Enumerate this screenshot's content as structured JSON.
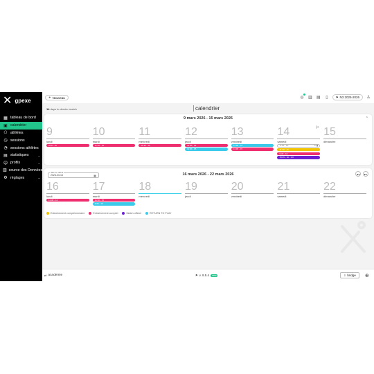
{
  "app": {
    "logo_text": "gpexe"
  },
  "sidebar": {
    "items": [
      {
        "label": "tableau de bord",
        "icon": "dashboard-icon",
        "glyph": "▦",
        "active": false,
        "caret": false
      },
      {
        "label": "calendrier",
        "icon": "calendar-icon",
        "glyph": "▣",
        "active": true,
        "caret": false
      },
      {
        "label": "athlètes",
        "icon": "athletes-icon",
        "glyph": "⚇",
        "active": false,
        "caret": false
      },
      {
        "label": "sessions",
        "icon": "sessions-icon",
        "glyph": "◷",
        "active": false,
        "caret": false
      },
      {
        "label": "sessions athlètes",
        "icon": "athlete-sessions-icon",
        "glyph": "◔",
        "active": false,
        "caret": false
      },
      {
        "label": "statistiques",
        "icon": "statistics-icon",
        "glyph": "▤",
        "active": false,
        "caret": true
      },
      {
        "label": "profils",
        "icon": "profiles-icon",
        "glyph": "☺",
        "active": false,
        "caret": true
      },
      {
        "label": "source des Données",
        "icon": "data-source-icon",
        "glyph": "▥",
        "active": false,
        "caret": false
      },
      {
        "label": "réglages",
        "icon": "settings-icon",
        "glyph": "⚙",
        "active": false,
        "caret": true
      }
    ]
  },
  "topbar": {
    "new_label": "Nouveau",
    "season_label": "N3 2025-2026"
  },
  "header": {
    "subtitle_prefix": "14",
    "subtitle_rest": "days to demier match",
    "title": "calendrier"
  },
  "weeks": [
    {
      "title": "9 mars 2026 - 15 mars 2026",
      "days": [
        {
          "num": "9",
          "name": "lundi",
          "today": false,
          "events": [
            {
              "t": "9:30 - 10",
              "c": "pink"
            }
          ]
        },
        {
          "num": "10",
          "name": "mardi",
          "today": false,
          "events": [
            {
              "t": "11:30 - 15",
              "c": "pink"
            }
          ]
        },
        {
          "num": "11",
          "name": "mercredi",
          "today": false,
          "events": [
            {
              "t": "11:30 - 15",
              "c": "pink"
            }
          ]
        },
        {
          "num": "12",
          "name": "jeudi",
          "today": false,
          "events": [
            {
              "t": "11:30 - 12",
              "c": "pink"
            },
            {
              "t": "11:30 - 15",
              "c": "cyan"
            }
          ]
        },
        {
          "num": "13",
          "name": "vendredi",
          "today": false,
          "events": [
            {
              "t": "11:30 - 12",
              "c": "cyan"
            },
            {
              "t": "11:30 - 15",
              "c": "pink"
            }
          ]
        },
        {
          "num": "14",
          "name": "samedi",
          "today": false,
          "events": [
            {
              "t": "9:30 - 10",
              "c": "edit"
            },
            {
              "t": "11:30 - 12",
              "c": "yellow"
            },
            {
              "t": "9:30 - 10",
              "c": "pink"
            },
            {
              "t": "15:45 - 16 - 2:0",
              "c": "purple"
            }
          ]
        },
        {
          "num": "15",
          "name": "dimanche",
          "today": false,
          "events": []
        }
      ]
    },
    {
      "title": "16 mars 2026 - 22 mars 2026",
      "date_label": "date de début",
      "date_value": "2026-03-16",
      "days": [
        {
          "num": "16",
          "name": "lundi",
          "today": false,
          "events": [
            {
              "t": "11:30 - 12",
              "c": "pink"
            }
          ]
        },
        {
          "num": "17",
          "name": "mardi",
          "today": false,
          "events": [
            {
              "t": "11:30 - 15",
              "c": "pink"
            },
            {
              "t": "9:30 - 10",
              "c": "cyan"
            }
          ]
        },
        {
          "num": "18",
          "name": "mercredi",
          "today": true,
          "events": []
        },
        {
          "num": "19",
          "name": "jeudi",
          "today": false,
          "events": []
        },
        {
          "num": "20",
          "name": "vendredi",
          "today": false,
          "events": []
        },
        {
          "num": "21",
          "name": "samedi",
          "today": false,
          "events": []
        },
        {
          "num": "22",
          "name": "dimanche",
          "today": false,
          "events": []
        }
      ]
    }
  ],
  "legend": [
    {
      "label": "Entraînement complémentaire",
      "color": "#f2c400"
    },
    {
      "label": "Entraînement complet",
      "color": "#ee2e6e"
    },
    {
      "label": "Match officiel",
      "color": "#6a1fd1"
    },
    {
      "label": "RETURN TO PLAY",
      "color": "#3ccaeb"
    }
  ],
  "footer": {
    "academy": "academie",
    "version": "v. 9.5.4",
    "version_badge": "new",
    "bridge": "bridge"
  },
  "colors": {
    "accent": "#22c58b",
    "sidebar_bg": "#000000"
  }
}
